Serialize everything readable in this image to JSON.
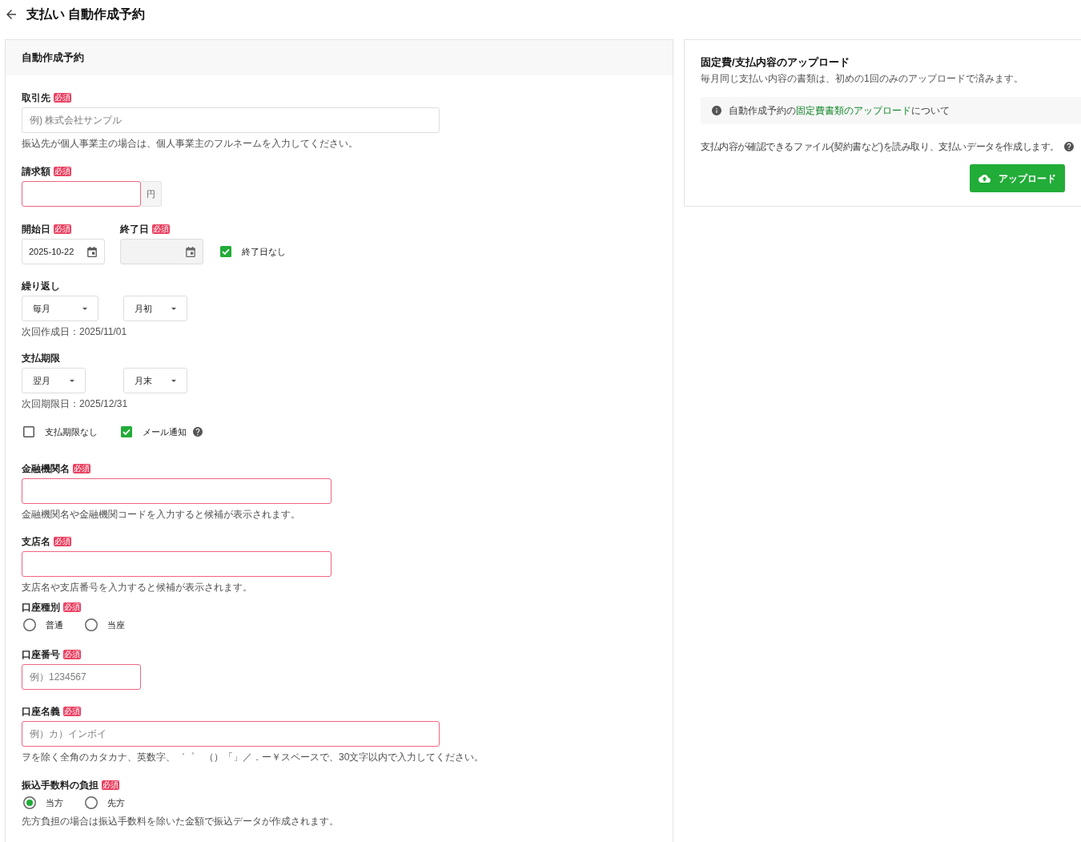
{
  "header": {
    "title": "支払い 自動作成予約"
  },
  "form": {
    "title": "自動作成予約",
    "partner": {
      "label": "取引先",
      "badge": "必須",
      "placeholder": "例) 株式会社サンプル",
      "invalid": false,
      "hint": "振込先が個人事業主の場合は、個人事業主のフルネームを入力してください。"
    },
    "amount": {
      "label": "請求額",
      "badge": "必須",
      "invalid": true,
      "unit": "円"
    },
    "start_date": {
      "label": "開始日",
      "badge": "必須",
      "value": "2025-10-22",
      "disabled": false
    },
    "end_date": {
      "label": "終了日",
      "badge": "必須",
      "disabled": true
    },
    "no_end_date": {
      "label": "終了日なし",
      "checked": true
    },
    "repeat": {
      "label": "繰り返し",
      "selects": [
        {
          "value": "毎月"
        },
        {
          "value": "月初"
        }
      ],
      "hint": "次回作成日：2025/11/01"
    },
    "due": {
      "label": "支払期限",
      "selects": [
        {
          "value": "翌月"
        },
        {
          "value": "月末"
        }
      ],
      "hint": "次回期限日：2025/12/31"
    },
    "options": [
      {
        "label": "支払期限なし",
        "checked": false,
        "help": false
      },
      {
        "label": "メール通知",
        "checked": true,
        "help": true
      }
    ],
    "bank": {
      "label": "金融機関名",
      "badge": "必須",
      "invalid": true,
      "hint": "金融機関名や金融機関コードを入力すると候補が表示されます。"
    },
    "branch": {
      "label": "支店名",
      "badge": "必須",
      "invalid": true,
      "hint": "支店名や支店番号を入力すると候補が表示されます。"
    },
    "account_type": {
      "label": "口座種別",
      "badge": "必須",
      "options": [
        {
          "label": "普通",
          "selected": false
        },
        {
          "label": "当座",
          "selected": false
        }
      ]
    },
    "account_number": {
      "label": "口座番号",
      "badge": "必須",
      "placeholder": "例）1234567",
      "invalid": true
    },
    "account_name": {
      "label": "口座名義",
      "badge": "必須",
      "placeholder": "例）カ）インボイ",
      "invalid": true,
      "hint": "ヲを除く全角のカタカナ、英数字、゛゜　（）「」／．ー￥スペースで、30文字以内で入力してください。"
    },
    "fee": {
      "label": "振込手数料の負担",
      "badge": "必須",
      "options": [
        {
          "label": "当方",
          "selected": true
        },
        {
          "label": "先方",
          "selected": false
        }
      ],
      "hint": "先方負担の場合は振込手数料を除いた金額で振込データが作成されます。"
    }
  },
  "upload": {
    "title": "固定費/支払内容のアップロード",
    "subtitle": "毎月同じ支払い内容の書類は、初めの1回のみのアップロードで済みます。",
    "notice": {
      "text_before": "自動作成予約の",
      "link": "固定費書類のアップロード",
      "text_after": "について"
    },
    "description": "支払内容が確認できるファイル(契約書など)を読み取り、支払いデータを作成します。",
    "button": "アップロード"
  }
}
